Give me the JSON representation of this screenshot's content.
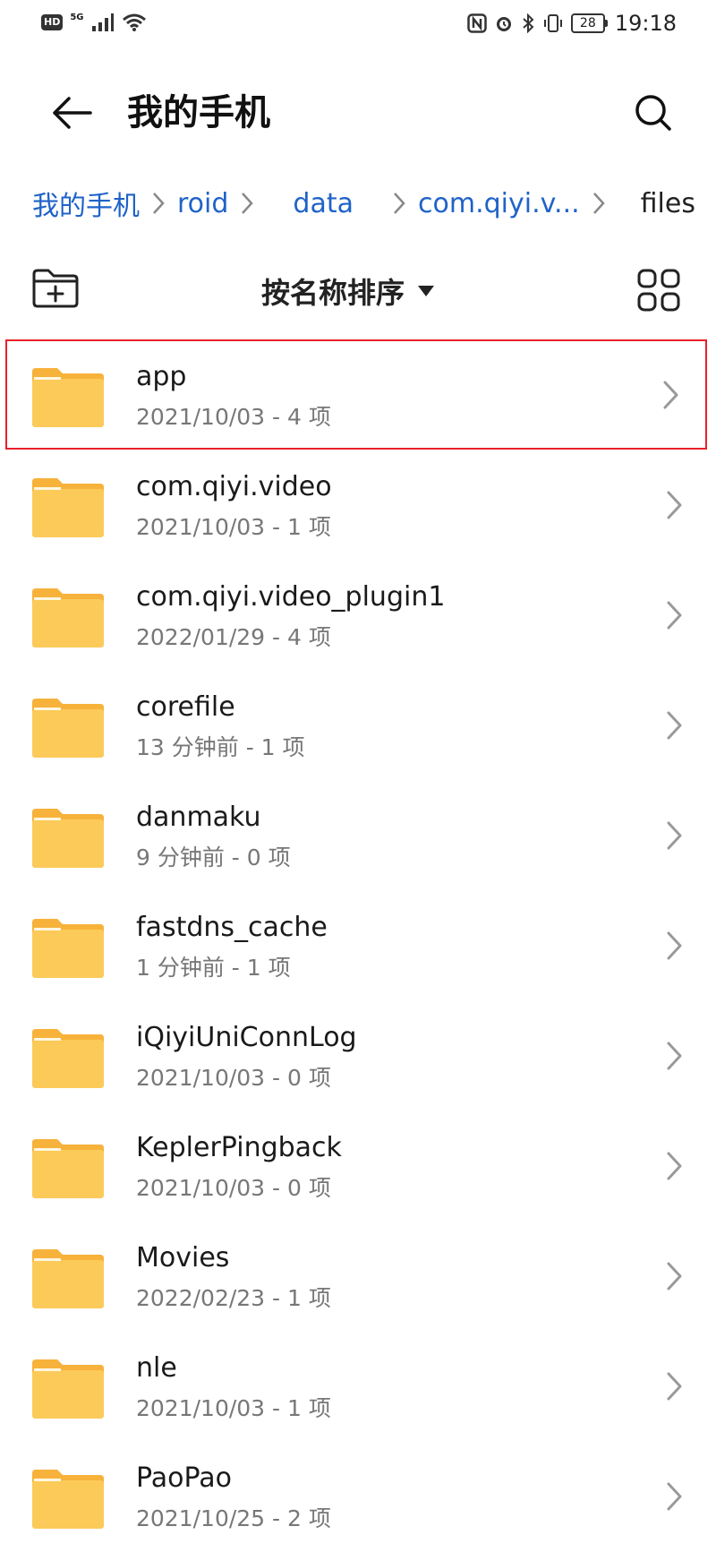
{
  "status_bar": {
    "hd": "HD",
    "network": "5G",
    "battery": "28",
    "time": "19:18"
  },
  "header": {
    "title": "我的手机"
  },
  "breadcrumb": [
    {
      "label": "我的手机",
      "current": false
    },
    {
      "label": "roid",
      "current": false
    },
    {
      "label": "data",
      "current": false
    },
    {
      "label": "com.qiyi.v...",
      "current": false
    },
    {
      "label": "files",
      "current": true
    }
  ],
  "toolbar": {
    "sort_label": "按名称排序"
  },
  "files": [
    {
      "name": "app",
      "meta": "2021/10/03 - 4 项",
      "highlighted": true
    },
    {
      "name": "com.qiyi.video",
      "meta": "2021/10/03 - 1 项"
    },
    {
      "name": "com.qiyi.video_plugin1",
      "meta": "2022/01/29 - 4 项"
    },
    {
      "name": "corefile",
      "meta": "13 分钟前 - 1 项"
    },
    {
      "name": "danmaku",
      "meta": "9 分钟前 - 0 项"
    },
    {
      "name": "fastdns_cache",
      "meta": "1 分钟前 - 1 项"
    },
    {
      "name": "iQiyiUniConnLog",
      "meta": "2021/10/03 - 0 项"
    },
    {
      "name": "KeplerPingback",
      "meta": "2021/10/03 - 0 项"
    },
    {
      "name": "Movies",
      "meta": "2022/02/23 - 1 项"
    },
    {
      "name": "nle",
      "meta": "2021/10/03 - 1 项"
    },
    {
      "name": "PaoPao",
      "meta": "2021/10/25 - 2 项"
    }
  ],
  "colors": {
    "accent": "#1f63c8",
    "folder": "#fcca59",
    "folder_tab": "#f7b23b",
    "highlight": "#e8202a"
  },
  "icons": {
    "back": "arrow-left-icon",
    "search": "search-icon",
    "new_folder": "folder-plus-icon",
    "sort": "caret-down-icon",
    "view": "grid-view-icon",
    "folder": "folder-icon",
    "chevron": "chevron-right-icon"
  }
}
